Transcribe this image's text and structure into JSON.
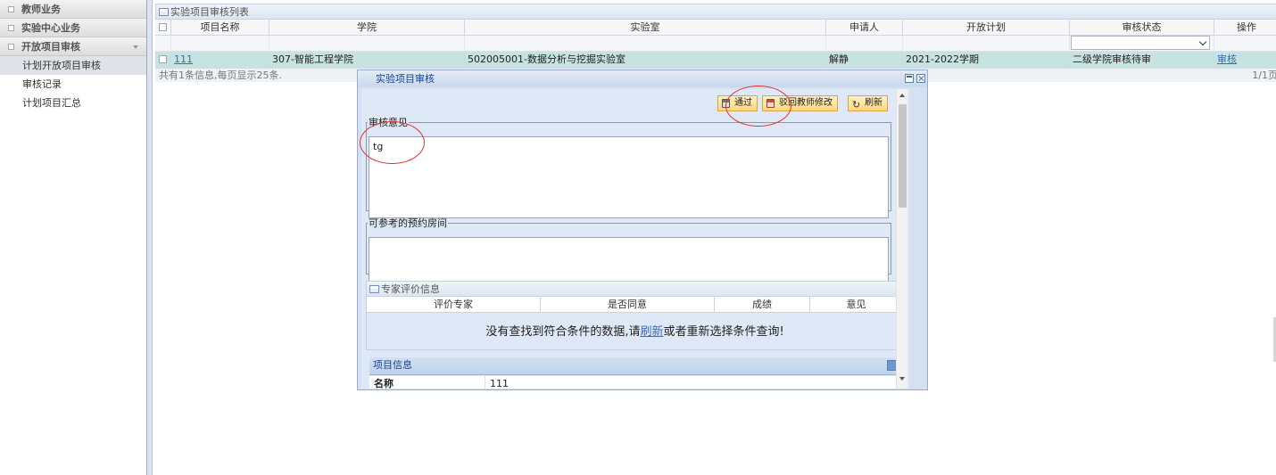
{
  "sidebar": {
    "groups": [
      {
        "label": "教师业务"
      },
      {
        "label": "实验中心业务"
      },
      {
        "label": "开放项目审核"
      }
    ],
    "items": [
      {
        "label": "计划开放项目审核"
      },
      {
        "label": "审核记录"
      },
      {
        "label": "计划项目汇总"
      }
    ]
  },
  "list": {
    "title": "实验项目审核列表",
    "columns": [
      "项目名称",
      "学院",
      "实验室",
      "申请人",
      "开放计划",
      "审核状态",
      "操作"
    ],
    "status_filter_value": "",
    "row": {
      "name": "111",
      "college": "307-智能工程学院",
      "lab": "502005001-数据分析与挖掘实验室",
      "applicant": "解静",
      "plan": "2021-2022学期",
      "status": "二级学院审核待审",
      "action": "审核"
    },
    "footer": "共有1条信息,每页显示25条.",
    "pages": "1/1页"
  },
  "dialog": {
    "title": "实验项目审核",
    "buttons": {
      "approve": "通过",
      "reject": "驳回教师修改",
      "refresh": "刷新"
    },
    "opinion_legend": "审核意见",
    "opinion_value": "tg",
    "rooms_legend": "可参考的预约房间",
    "rooms_value": "",
    "expert_panel": {
      "title": "专家评价信息",
      "columns": [
        "评价专家",
        "是否同意",
        "成绩",
        "意见"
      ],
      "empty_prefix": "没有查找到符合条件的数据,请",
      "empty_link": "刷新",
      "empty_suffix": "或者重新选择条件查询!"
    },
    "project_info_label": "项目信息",
    "info_row": {
      "label": "名称",
      "value": "111"
    }
  },
  "colors": {
    "annotation": "#e0312d",
    "selected_row": "#c7e3df",
    "dialog_title": "#15428b",
    "button_fill": "#ffd77a"
  }
}
